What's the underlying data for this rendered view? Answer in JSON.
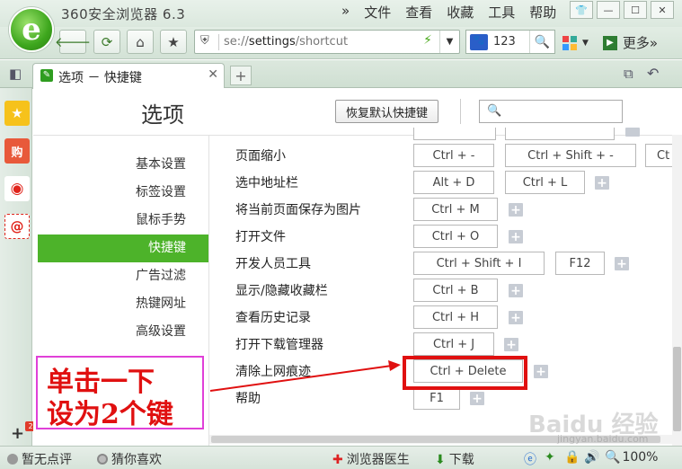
{
  "window": {
    "app_title": "360安全浏览器 6.3",
    "menu": [
      "文件",
      "查看",
      "收藏",
      "工具",
      "帮助"
    ],
    "menu_chevron": "»"
  },
  "toolbar": {
    "address_prefix": "se://",
    "address_path": "settings",
    "address_suffix": "/shortcut",
    "search_value": "123",
    "more_label": "更多»"
  },
  "tab": {
    "label": "选项 － 快捷键"
  },
  "settings": {
    "title": "选项",
    "restore_button": "恢复默认快捷键",
    "search_placeholder": "",
    "nav": [
      {
        "label": "基本设置",
        "active": false
      },
      {
        "label": "标签设置",
        "active": false
      },
      {
        "label": "鼠标手势",
        "active": false
      },
      {
        "label": "快捷键",
        "active": true
      },
      {
        "label": "广告过滤",
        "active": false
      },
      {
        "label": "热键网址",
        "active": false
      },
      {
        "label": "高级设置",
        "active": false
      }
    ],
    "shortcuts": [
      {
        "label": "页面缩小",
        "keys": [
          "Ctrl  +  -",
          "Ctrl  +  Shift  +  -",
          "Ct"
        ]
      },
      {
        "label": "选中地址栏",
        "keys": [
          "Alt  +  D",
          "Ctrl  +  L"
        ]
      },
      {
        "label": "将当前页面保存为图片",
        "keys": [
          "Ctrl  +  M"
        ]
      },
      {
        "label": "打开文件",
        "keys": [
          "Ctrl  +  O"
        ]
      },
      {
        "label": "开发人员工具",
        "keys": [
          "Ctrl  +  Shift  +  I",
          "F12"
        ]
      },
      {
        "label": "显示/隐藏收藏栏",
        "keys": [
          "Ctrl  +  B"
        ]
      },
      {
        "label": "查看历史记录",
        "keys": [
          "Ctrl  +  H"
        ]
      },
      {
        "label": "打开下载管理器",
        "keys": [
          "Ctrl  +  J"
        ]
      },
      {
        "label": "清除上网痕迹",
        "keys": [
          "Ctrl  +  Delete"
        ]
      },
      {
        "label": "帮助",
        "keys": [
          "F1"
        ]
      }
    ]
  },
  "annotation": {
    "line1": "单击一下",
    "line2": "设为2个键"
  },
  "sidebar": {
    "badge": "2"
  },
  "statusbar": {
    "rating": "暂无点评",
    "guess": "猜你喜欢",
    "doctor": "浏览器医生",
    "download": "下载",
    "zoom": "100%"
  },
  "watermark": {
    "main": "Baidu 经验",
    "sub": "jingyan.baidu.com"
  }
}
